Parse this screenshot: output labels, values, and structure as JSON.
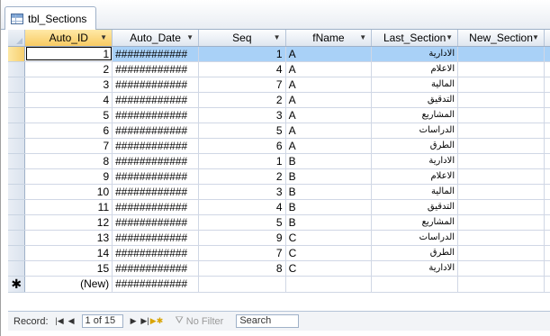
{
  "window": {
    "tab_title": "tbl_Sections"
  },
  "columns": [
    {
      "label": "Auto_ID",
      "has_dropdown": true
    },
    {
      "label": "Auto_Date",
      "has_dropdown": true
    },
    {
      "label": "Seq",
      "has_dropdown": true
    },
    {
      "label": "fName",
      "has_dropdown": true
    },
    {
      "label": "Last_Section",
      "has_dropdown": true
    },
    {
      "label": "New_Section",
      "has_dropdown": true
    }
  ],
  "rows": [
    {
      "id": "1",
      "date": "############",
      "seq": "1",
      "fname": "A",
      "last_section": "الادارية",
      "new_section": ""
    },
    {
      "id": "2",
      "date": "############",
      "seq": "4",
      "fname": "A",
      "last_section": "الاعلام",
      "new_section": ""
    },
    {
      "id": "3",
      "date": "############",
      "seq": "7",
      "fname": "A",
      "last_section": "المالية",
      "new_section": ""
    },
    {
      "id": "4",
      "date": "############",
      "seq": "2",
      "fname": "A",
      "last_section": "التدقيق",
      "new_section": ""
    },
    {
      "id": "5",
      "date": "############",
      "seq": "3",
      "fname": "A",
      "last_section": "المشاريع",
      "new_section": ""
    },
    {
      "id": "6",
      "date": "############",
      "seq": "5",
      "fname": "A",
      "last_section": "الدراسات",
      "new_section": ""
    },
    {
      "id": "7",
      "date": "############",
      "seq": "6",
      "fname": "A",
      "last_section": "الطرق",
      "new_section": ""
    },
    {
      "id": "8",
      "date": "############",
      "seq": "1",
      "fname": "B",
      "last_section": "الادارية",
      "new_section": ""
    },
    {
      "id": "9",
      "date": "############",
      "seq": "2",
      "fname": "B",
      "last_section": "الاعلام",
      "new_section": ""
    },
    {
      "id": "10",
      "date": "############",
      "seq": "3",
      "fname": "B",
      "last_section": "المالية",
      "new_section": ""
    },
    {
      "id": "11",
      "date": "############",
      "seq": "4",
      "fname": "B",
      "last_section": "التدقيق",
      "new_section": ""
    },
    {
      "id": "12",
      "date": "############",
      "seq": "5",
      "fname": "B",
      "last_section": "المشاريع",
      "new_section": ""
    },
    {
      "id": "13",
      "date": "############",
      "seq": "9",
      "fname": "C",
      "last_section": "الدراسات",
      "new_section": ""
    },
    {
      "id": "14",
      "date": "############",
      "seq": "7",
      "fname": "C",
      "last_section": "الطرق",
      "new_section": ""
    },
    {
      "id": "15",
      "date": "############",
      "seq": "8",
      "fname": "C",
      "last_section": "الادارية",
      "new_section": ""
    }
  ],
  "new_row": {
    "marker": "✱",
    "id": "(New)",
    "date": "############"
  },
  "navigation": {
    "record_label": "Record:",
    "position": "1 of 15",
    "filter_label": "No Filter",
    "search_placeholder": "Search"
  },
  "icons": {
    "first": "first-record-icon",
    "prev": "previous-record-icon",
    "next": "next-record-icon",
    "last": "last-record-icon",
    "new": "new-record-icon",
    "filter": "filter-icon",
    "table": "table-icon"
  },
  "colors": {
    "selection": "#a9d1f7",
    "active_header": "#f8cb62"
  }
}
